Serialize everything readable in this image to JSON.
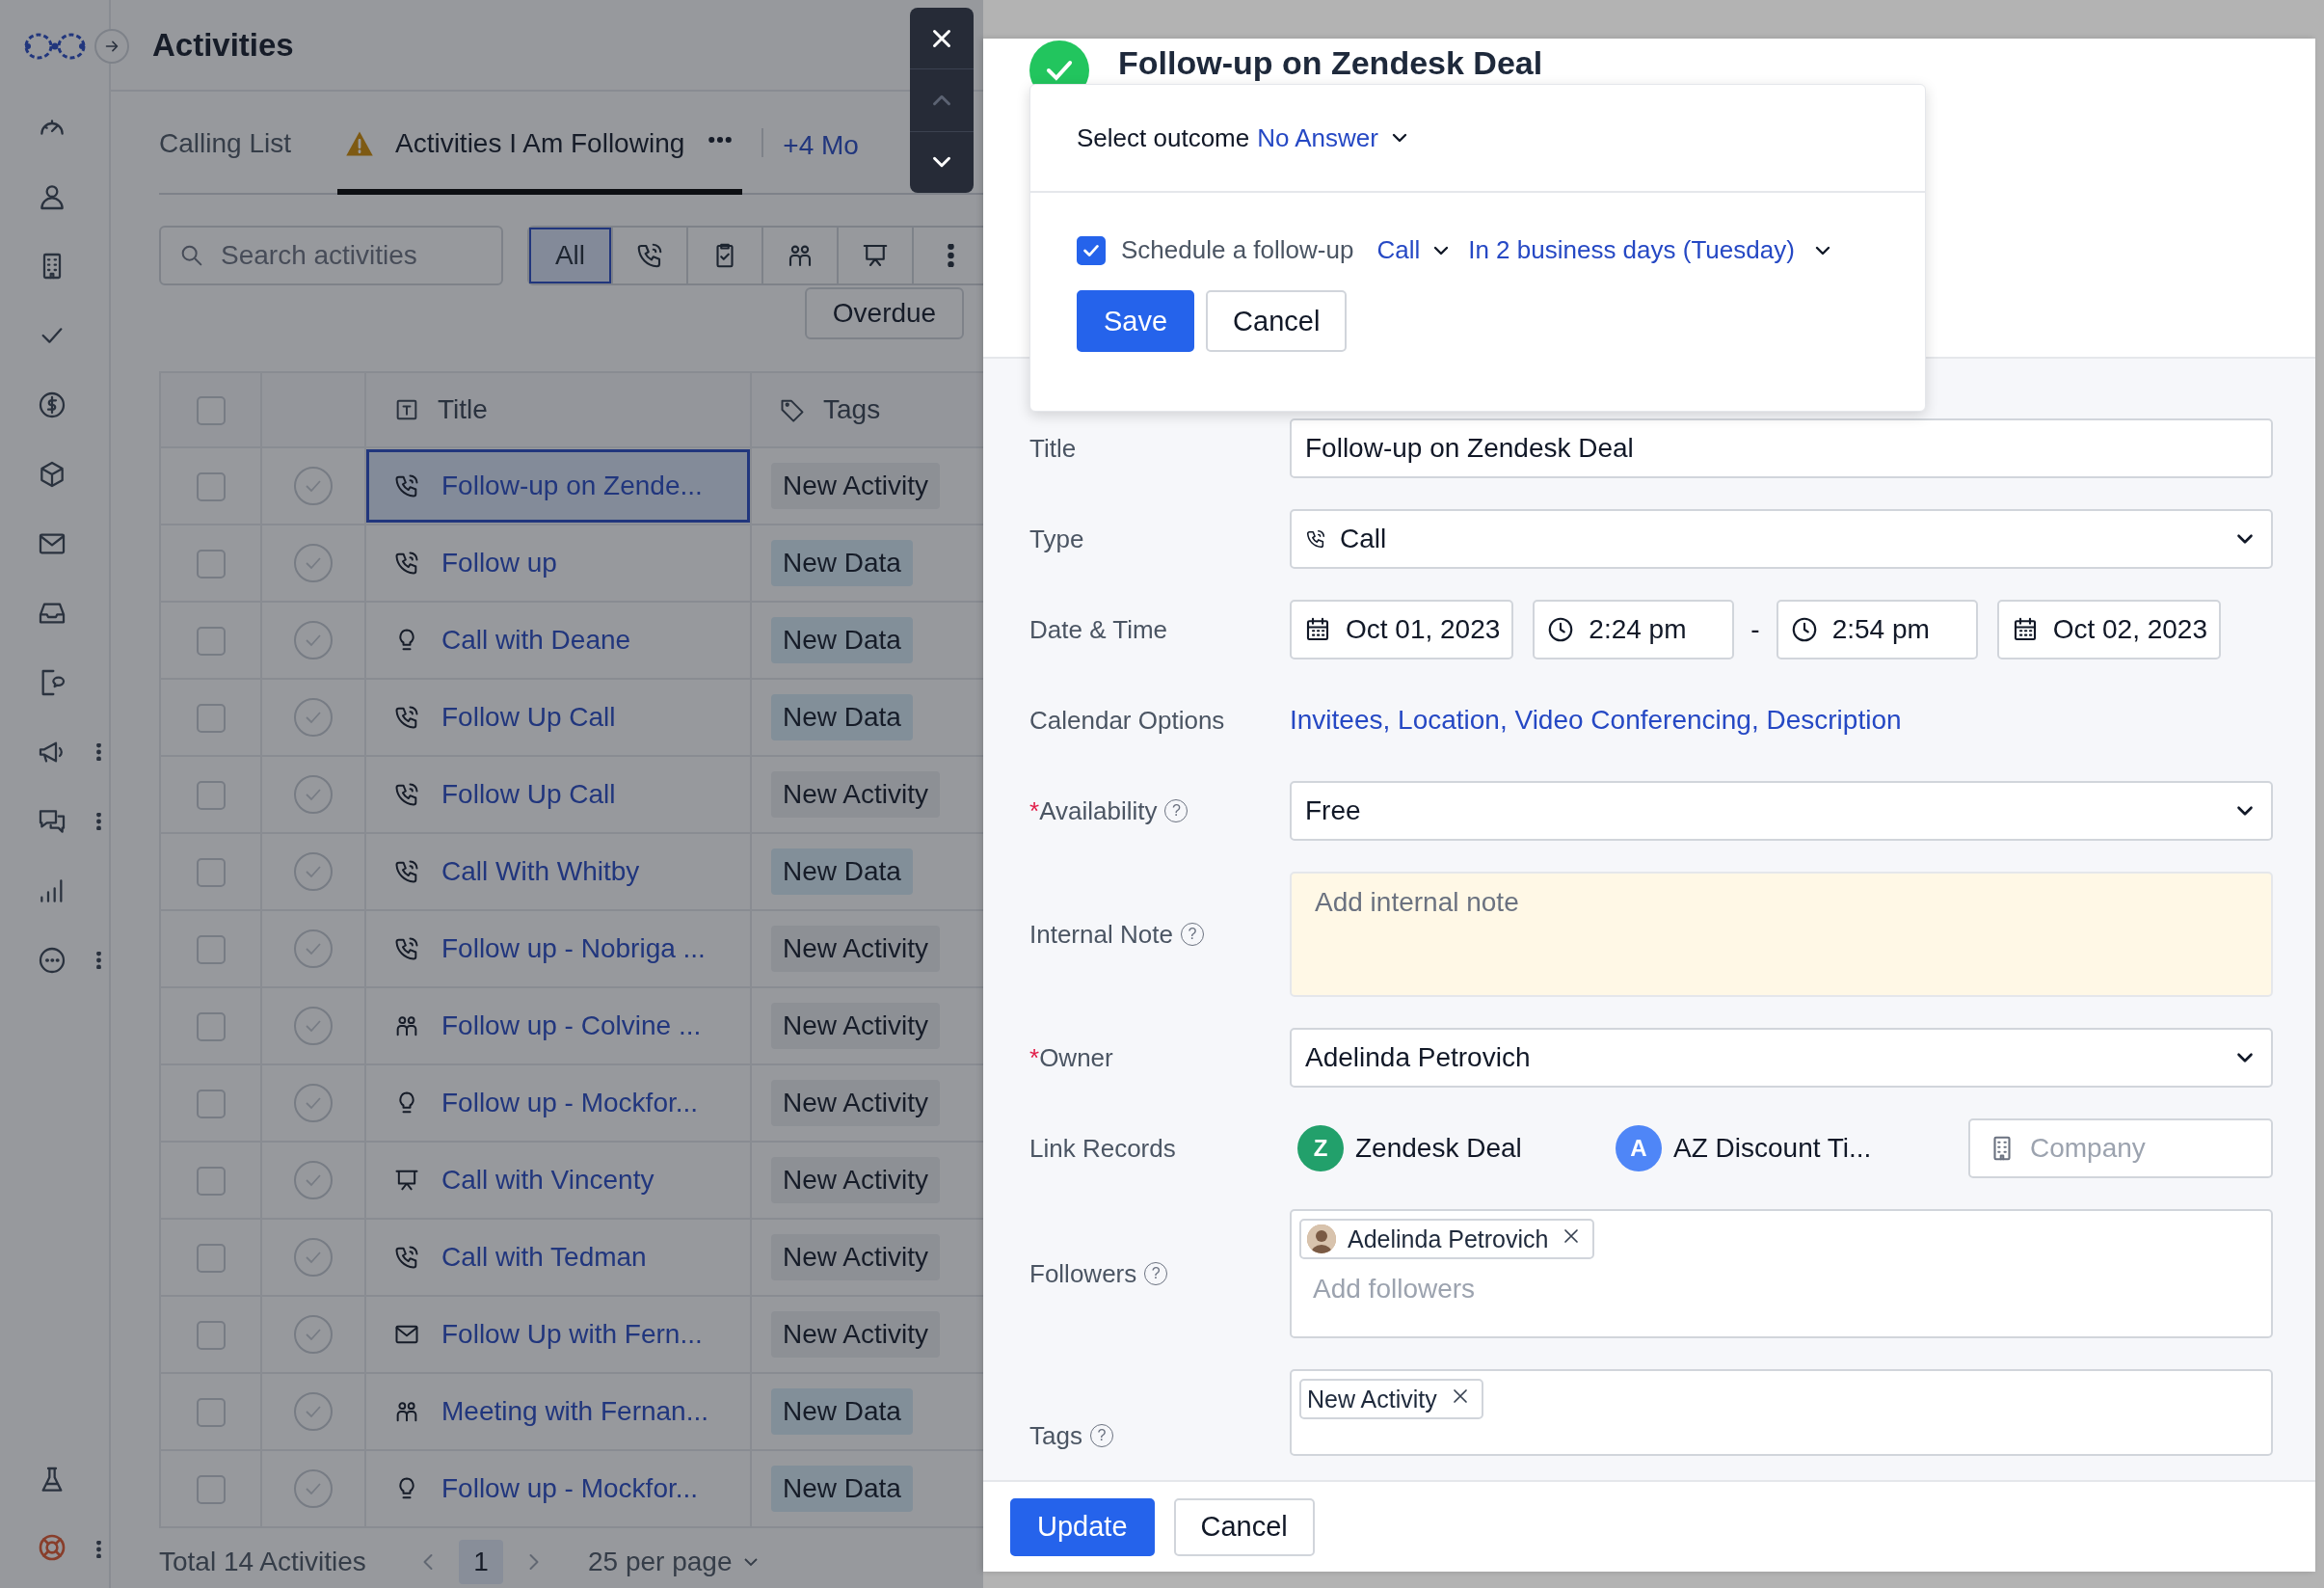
{
  "header": {
    "title": "Activities"
  },
  "tabs": [
    {
      "label": "Calling List",
      "selected": false,
      "warning": false
    },
    {
      "label": "Activities I Am Following",
      "selected": true,
      "warning": true
    }
  ],
  "more_tabs": "+4 Mo",
  "search": {
    "placeholder": "Search activities"
  },
  "filters": [
    {
      "kind": "all",
      "label": "All",
      "selected": true
    },
    {
      "kind": "call",
      "selected": false
    },
    {
      "kind": "task",
      "selected": false
    },
    {
      "kind": "meeting",
      "selected": false
    },
    {
      "kind": "demo",
      "selected": false
    },
    {
      "kind": "more",
      "selected": false
    }
  ],
  "overdue_button": "Overdue",
  "table": {
    "all_checked": false,
    "columns": {
      "title": "Title",
      "tags": "Tags"
    },
    "rows": [
      {
        "checked": false,
        "selected": true,
        "kind": "call",
        "title": "Follow-up on Zende...",
        "tag": {
          "label": "New Activity",
          "kind": "activity"
        }
      },
      {
        "checked": false,
        "selected": false,
        "kind": "call",
        "title": "Follow up",
        "tag": {
          "label": "New Data",
          "kind": "data"
        }
      },
      {
        "checked": false,
        "selected": false,
        "kind": "idea",
        "title": "Call with Deane",
        "tag": {
          "label": "New Data",
          "kind": "data"
        }
      },
      {
        "checked": false,
        "selected": false,
        "kind": "call",
        "title": "Follow Up Call",
        "tag": {
          "label": "New Data",
          "kind": "data"
        }
      },
      {
        "checked": false,
        "selected": false,
        "kind": "call",
        "title": "Follow Up Call",
        "tag": {
          "label": "New Activity",
          "kind": "activity"
        }
      },
      {
        "checked": false,
        "selected": false,
        "kind": "call",
        "title": "Call With Whitby",
        "tag": {
          "label": "New Data",
          "kind": "data"
        }
      },
      {
        "checked": false,
        "selected": false,
        "kind": "call",
        "title": "Follow up - Nobriga ...",
        "tag": {
          "label": "New Activity",
          "kind": "activity"
        }
      },
      {
        "checked": false,
        "selected": false,
        "kind": "meeting",
        "title": "Follow up - Colvine ...",
        "tag": {
          "label": "New Activity",
          "kind": "activity"
        }
      },
      {
        "checked": false,
        "selected": false,
        "kind": "idea",
        "title": "Follow up - Mockfor...",
        "tag": {
          "label": "New Activity",
          "kind": "activity"
        }
      },
      {
        "checked": false,
        "selected": false,
        "kind": "demo",
        "title": "Call with Vincenty",
        "tag": {
          "label": "New Activity",
          "kind": "activity"
        }
      },
      {
        "checked": false,
        "selected": false,
        "kind": "call",
        "title": "Call with Tedman",
        "tag": {
          "label": "New Activity",
          "kind": "activity"
        }
      },
      {
        "checked": false,
        "selected": false,
        "kind": "email",
        "title": "Follow Up with Fern...",
        "tag": {
          "label": "New Activity",
          "kind": "activity"
        }
      },
      {
        "checked": false,
        "selected": false,
        "kind": "meeting",
        "title": "Meeting with Fernan...",
        "tag": {
          "label": "New Data",
          "kind": "data"
        }
      },
      {
        "checked": false,
        "selected": false,
        "kind": "idea",
        "title": "Follow up - Mockfor...",
        "tag": {
          "label": "New Data",
          "kind": "data"
        }
      }
    ]
  },
  "pagination": {
    "total": "Total 14 Activities",
    "page": "1",
    "page_size": "25 per page"
  },
  "drawer": {
    "title": "Follow-up on Zendesk Deal",
    "completed": true,
    "popover": {
      "outcome_label": "Select outcome",
      "outcome": "No Answer",
      "follow_up": {
        "checked": true,
        "label": "Schedule a follow-up",
        "type": "Call",
        "when": "In 2 business days (Tuesday)"
      },
      "buttons": [
        {
          "label": "Save",
          "primary": true
        },
        {
          "label": "Cancel",
          "primary": false
        }
      ]
    },
    "fields": [
      {
        "kind": "text",
        "label": "Title",
        "value": "Follow-up on Zendesk Deal"
      },
      {
        "kind": "call_select",
        "label": "Type",
        "value": "Call"
      },
      {
        "kind": "datetime",
        "label": "Date & Time",
        "start_date": "Oct 01, 2023",
        "start_time": "2:24 pm",
        "separator": "-",
        "end_time": "2:54 pm",
        "end_date": "Oct 02, 2023"
      },
      {
        "kind": "links",
        "label": "Calendar Options",
        "value": "Invitees, Location, Video Conferencing, Description"
      },
      {
        "kind": "select",
        "label": "Availability",
        "required_mark": "*",
        "help": "?",
        "value": "Free"
      },
      {
        "kind": "textarea",
        "label": "Internal Note",
        "help": "?",
        "placeholder": "Add internal note"
      },
      {
        "kind": "select",
        "label": "Owner",
        "required_mark": "*",
        "value": "Adelinda Petrovich"
      },
      {
        "kind": "records",
        "label": "Link Records",
        "records": [
          {
            "initial": "Z",
            "name": "Zendesk Deal",
            "color": "#22a06b"
          },
          {
            "initial": "A",
            "name": "AZ Discount Ti...",
            "color": "#4f86f7"
          }
        ],
        "company_placeholder": "Company"
      },
      {
        "kind": "people",
        "label": "Followers",
        "help": "?",
        "chips": [
          {
            "name": "Adelinda Petrovich"
          }
        ],
        "placeholder": "Add followers"
      },
      {
        "kind": "tags",
        "label": "Tags",
        "help": "?",
        "chips": [
          {
            "name": "New Activity"
          }
        ]
      }
    ],
    "footer_buttons": [
      {
        "label": "Update",
        "primary": true
      },
      {
        "label": "Cancel",
        "primary": false
      }
    ]
  }
}
